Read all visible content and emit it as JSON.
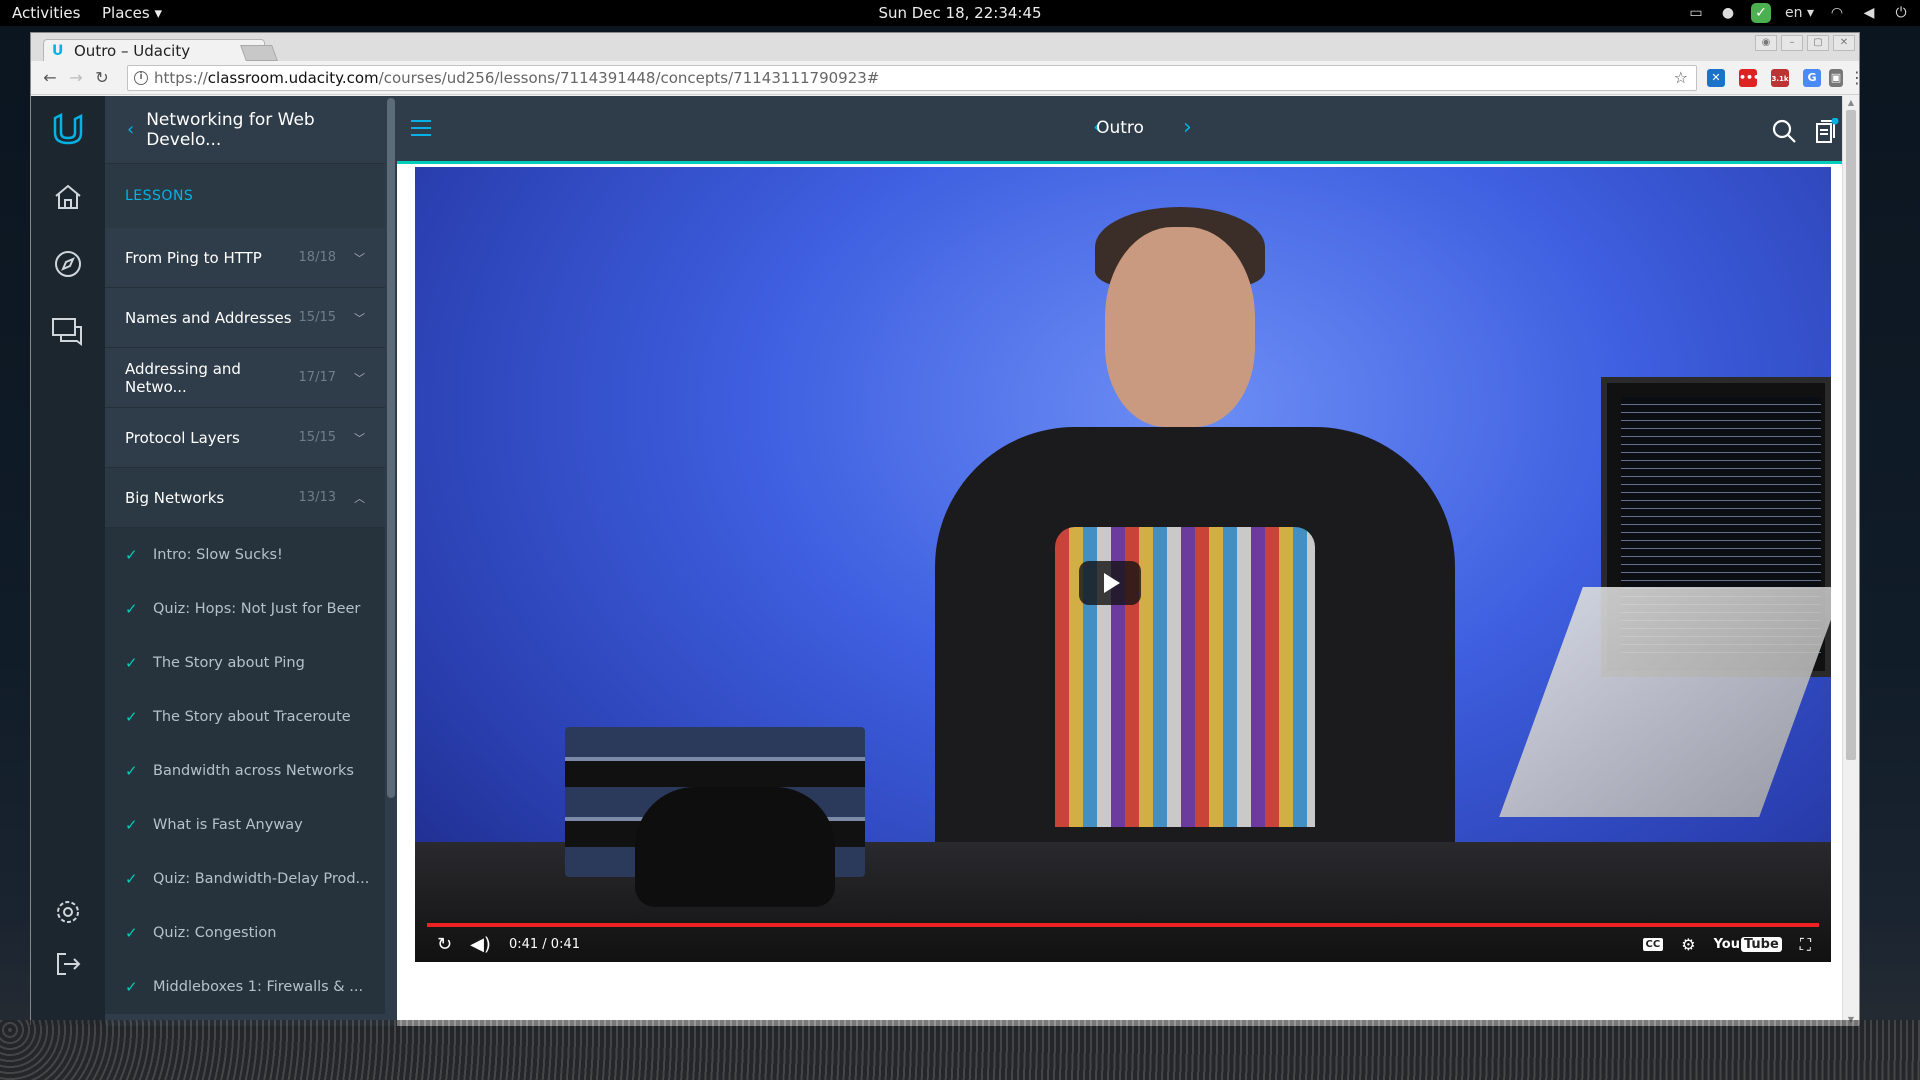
{
  "desktop": {
    "activities": "Activities",
    "places": "Places",
    "clock": "Sun Dec 18, 22:34:45",
    "lang": "en"
  },
  "browser": {
    "tab_title": "Outro – Udacity",
    "url_scheme": "https://",
    "url_domain": "classroom.udacity.com",
    "url_path": "/courses/ud256/lessons/7114391448/concepts/71143111790923#",
    "extension_badge": "3.1k"
  },
  "sidebar": {
    "course_title": "Networking for Web Develo...",
    "lessons_label": "LESSONS",
    "lessons": [
      {
        "title": "From Ping to HTTP",
        "count": "18/18"
      },
      {
        "title": "Names and Addresses",
        "count": "15/15"
      },
      {
        "title": "Addressing and Netwo...",
        "count": "17/17"
      },
      {
        "title": "Protocol Layers",
        "count": "15/15"
      },
      {
        "title": "Big Networks",
        "count": "13/13"
      }
    ],
    "concepts": [
      "Intro: Slow Sucks!",
      "Quiz: Hops: Not Just for Beer",
      "The Story about Ping",
      "The Story about Traceroute",
      "Bandwidth across Networks",
      "What is Fast Anyway",
      "Quiz: Bandwidth-Delay Prod...",
      "Quiz: Congestion",
      "Middleboxes 1: Firewalls & ..."
    ]
  },
  "header": {
    "concept_title": "Outro"
  },
  "video": {
    "time": "0:41 / 0:41",
    "progress_fraction": 1.0,
    "youtube_label": "You",
    "youtube_tube": "Tube"
  },
  "colors": {
    "accent": "#02b3e4",
    "teal": "#02ccba",
    "sidebar_bg": "#2e3d49",
    "rail_bg": "#1c262f"
  }
}
